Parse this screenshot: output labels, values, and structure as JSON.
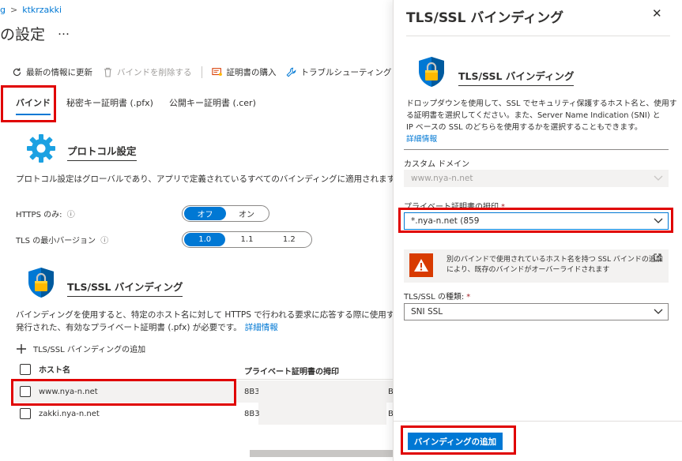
{
  "breadcrumb": {
    "prev": "g",
    "current": "ktkrzakki"
  },
  "page": {
    "title": "の設定",
    "more": "…"
  },
  "toolbar": {
    "refresh": "最新の情報に更新",
    "delete_binding": "バインドを削除する",
    "buy_cert": "証明書の購入",
    "troubleshoot": "トラブルシューティング",
    "help": "?"
  },
  "tabs": [
    {
      "label": "バインド"
    },
    {
      "label": "秘密キー証明書 (.pfx)"
    },
    {
      "label": "公開キー証明書 (.cer)"
    }
  ],
  "protocol": {
    "heading": "プロトコル設定",
    "description": "プロトコル設定はグローバルであり、アプリで定義されているすべてのバインディングに適用されます。",
    "https_only_label": "HTTPS のみ:",
    "https_options": [
      "オフ",
      "オン"
    ],
    "tls_label": "TLS の最小バージョン",
    "tls_options": [
      "1.0",
      "1.1",
      "1.2"
    ],
    "info_glyph": "ⓘ"
  },
  "bindings": {
    "heading": "TLS/SSL バインディング",
    "desc_line1": "バインディングを使用すると、特定のホスト名に対して HTTPS で行われる要求に応答する際に使用する証",
    "desc_line2": "発行された、有効なプライベート証明書 (.pfx) が必要です。",
    "learn_more": "詳細情報",
    "add_label": "TLS/SSL バインディングの追加",
    "col_host": "ホスト名",
    "col_thumb": "プライベート証明書の拇印",
    "rows": [
      {
        "host": "www.nya-n.net",
        "thumb": "8B3",
        "thumb_tail": "B"
      },
      {
        "host": "zakki.nya-n.net",
        "thumb": "8B3",
        "thumb_tail": "B"
      }
    ]
  },
  "panel": {
    "title": "TLS/SSL バインディング",
    "close": "✕",
    "heading": "TLS/SSL バインディング",
    "desc_line1": "ドロップダウンを使用して、SSL でセキュリティ保護するホスト名と、使用す",
    "desc_line2": "る証明書を選択してください。また、Server Name Indication (SNI) と",
    "desc_line3": "IP ベースの SSL のどちらを使用するかを選択することもできます。",
    "learn_more": "詳細情報",
    "domain_label": "カスタム ドメイン",
    "domain_value": "www.nya-n.net",
    "thumb_label": "プライベート証明書の拇印",
    "required_mark": "*",
    "thumb_value": "*.nya-n.net (859",
    "warning_line1": "別のバインドで使用されているホスト名を持つ SSL バインドの追加",
    "warning_line2": "により、既存のバインドがオーバーライドされます",
    "ssl_type_label": "TLS/SSL の種類:",
    "ssl_type_value": "SNI SSL",
    "add_button": "バインディングの追加"
  },
  "colors": {
    "accent": "#0078d4",
    "warning": "#d83b01",
    "highlight_box": "#e00000"
  },
  "icons": [
    "refresh-icon",
    "trash-icon",
    "certificate-purchase-icon",
    "wrench-icon",
    "gear-icon",
    "shield-lock-icon",
    "plus-icon",
    "warning-icon",
    "external-link-icon",
    "chevron-down-icon",
    "close-icon"
  ]
}
